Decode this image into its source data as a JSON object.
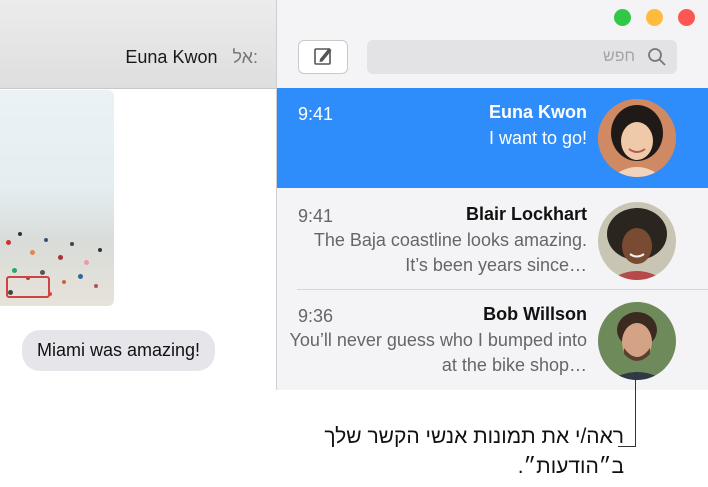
{
  "conversation": {
    "to_label": "אל:",
    "recipient": "Euna Kwon",
    "message_bubble": "Miami was amazing!"
  },
  "toolbar": {
    "search_placeholder": "חפש"
  },
  "messages": [
    {
      "time": "9:41",
      "name": "Euna Kwon",
      "preview": "I want to go!",
      "selected": true
    },
    {
      "time": "9:41",
      "name": "Blair Lockhart",
      "preview": "The Baja coastline looks amazing. It’s been years since…",
      "selected": false
    },
    {
      "time": "9:36",
      "name": "Bob Willson",
      "preview": "You’ll never guess who I bumped into at the bike shop…",
      "selected": false
    }
  ],
  "callout": {
    "text": "ראה/י את תמונות אנשי הקשר שלך ב״הודעות״."
  },
  "colors": {
    "accent": "#2f8dfb",
    "close": "#fc5753",
    "minimize": "#fdbc40",
    "zoom": "#33c748"
  },
  "icons": [
    "close-button",
    "minimize-button",
    "zoom-button",
    "compose-icon",
    "search-icon"
  ]
}
